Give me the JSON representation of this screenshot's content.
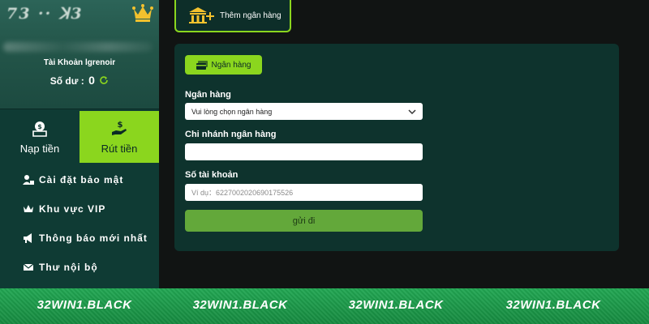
{
  "sidebar": {
    "logo_text": "73 ·· ꓘ3",
    "account_label": "Tài Khoản lgrenoir",
    "balance_label": "Số dư :",
    "balance_value": "0",
    "tabs": [
      {
        "label": "Nạp tiền",
        "icon": "money-bag-icon",
        "active": false
      },
      {
        "label": "Rút tiền",
        "icon": "hand-money-icon",
        "active": true
      }
    ],
    "menu": [
      {
        "label": "Cài đặt bảo mật",
        "icon": "user-lock-icon"
      },
      {
        "label": "Khu vực VIP",
        "icon": "crown-icon"
      },
      {
        "label": "Thông báo mới nhất",
        "icon": "megaphone-icon"
      },
      {
        "label": "Thư nội bộ",
        "icon": "envelope-icon"
      }
    ]
  },
  "main": {
    "add_bank_label": "Thêm ngân hàng",
    "chip_label": "Ngân hàng",
    "bank": {
      "label": "Ngân hàng",
      "selected": "Vui lòng chọn ngân hàng"
    },
    "branch": {
      "label": "Chi nhánh ngân hàng",
      "value": ""
    },
    "account": {
      "label": "Số tài khoản",
      "placeholder": "Ví dụ：6227002020690175526"
    },
    "submit_label": "gửi đi"
  },
  "footer": {
    "items": [
      "32WIN1.BLACK",
      "32WIN1.BLACK",
      "32WIN1.BLACK",
      "32WIN1.BLACK"
    ]
  },
  "colors": {
    "accent": "#8bd61e",
    "sidebar_bg": "#0f3b34",
    "panel_bg": "#0e332d",
    "page_bg": "#111413",
    "submit_bg": "#63a83a",
    "footer_bg": "#1b9a4a",
    "crown": "#f2c12e"
  }
}
